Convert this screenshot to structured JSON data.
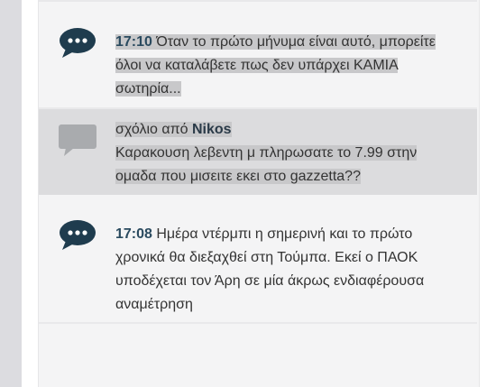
{
  "feed": {
    "entries": [
      {
        "kind": "live-update",
        "time": "17:10",
        "text": "Όταν το πρώτο μήνυμα είναι αυτό, μπορείτε όλοι να καταλάβετε πως δεν υπάρχει ΚΑΜΙΑ σωτηρία...",
        "icon": "chat-bubble-dots-icon"
      },
      {
        "kind": "comment",
        "prefix": "σχόλιο από",
        "author": "Nikos",
        "text": "Καρακουση λεβεντη μ πληρωσατε το 7.99 στην ομαδα που μισειτε εκει στο gazzetta??",
        "icon": "comment-bubble-icon"
      },
      {
        "kind": "live-update",
        "time": "17:08",
        "text": "Ημέρα ντέρμπι η σημερινή και το πρώτο χρονικά θα διεξαχθεί στη Τούμπα. Εκεί ο ΠΑΟΚ υποδέχεται τον Άρη σε μία άκρως ενδιαφέρουσα αναμέτρηση",
        "icon": "chat-bubble-dots-icon"
      }
    ]
  },
  "colors": {
    "icon_live": "#1f3c4e",
    "icon_comment": "#a9abae",
    "time_text": "#2a4a5f",
    "highlight": "#c8c8ca"
  }
}
